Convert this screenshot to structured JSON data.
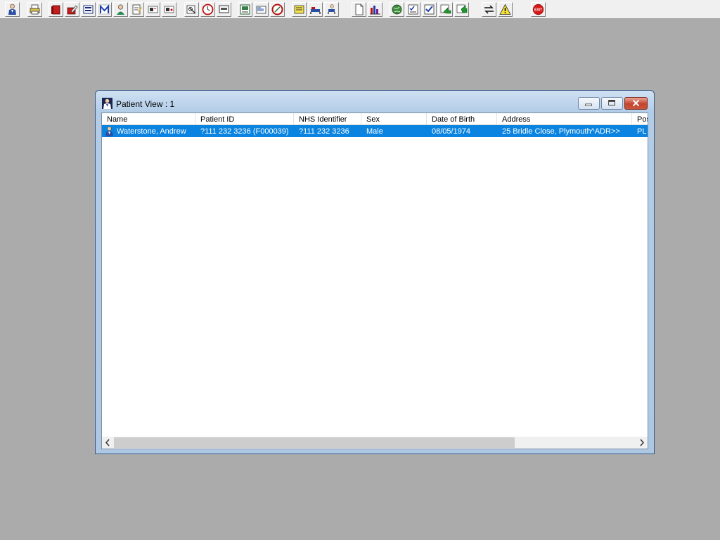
{
  "toolbar": {
    "buttons": [
      {
        "icon": "patient-icon"
      },
      {
        "icon": "printer-icon"
      },
      {
        "icon": "book-icon"
      },
      {
        "icon": "edit-record-icon"
      },
      {
        "icon": "list-view-icon"
      },
      {
        "icon": "mail-m-icon"
      },
      {
        "icon": "clinician-icon"
      },
      {
        "icon": "notepad-icon"
      },
      {
        "icon": "flag-icon"
      },
      {
        "icon": "flag-alt-icon"
      },
      {
        "icon": "search-records-icon"
      },
      {
        "icon": "clock-icon"
      },
      {
        "icon": "monitor-icon"
      },
      {
        "icon": "results-icon"
      },
      {
        "icon": "letter-icon"
      },
      {
        "icon": "stop-icon"
      },
      {
        "icon": "note-yellow-icon"
      },
      {
        "icon": "hospital-bed-icon"
      },
      {
        "icon": "chair-icon"
      },
      {
        "icon": "document-icon"
      },
      {
        "icon": "bar-chart-icon"
      },
      {
        "icon": "globe-icon"
      },
      {
        "icon": "checklist-icon"
      },
      {
        "icon": "checklist-blue-icon"
      },
      {
        "icon": "sync-green-icon"
      },
      {
        "icon": "refresh-green-icon"
      },
      {
        "icon": "transfer-arrows-icon"
      },
      {
        "icon": "warning-icon"
      },
      {
        "icon": "exit-icon",
        "label": "EXIT"
      }
    ]
  },
  "window": {
    "title": "Patient View : 1",
    "columns": [
      "Name",
      "Patient ID",
      "NHS Identifier",
      "Sex",
      "Date of Birth",
      "Address",
      "Pos"
    ],
    "rows": [
      {
        "name": "Waterstone, Andrew",
        "patient_id": "?111 232 3236 (F000039)",
        "nhs_identifier": "?111 232 3236",
        "sex": "Male",
        "date_of_birth": "08/05/1974",
        "address": "25 Bridle Close, Plymouth^ADR>>",
        "postcode": "PL"
      }
    ]
  },
  "colors": {
    "selection": "#0a84e0",
    "desktop": "#ababab"
  }
}
